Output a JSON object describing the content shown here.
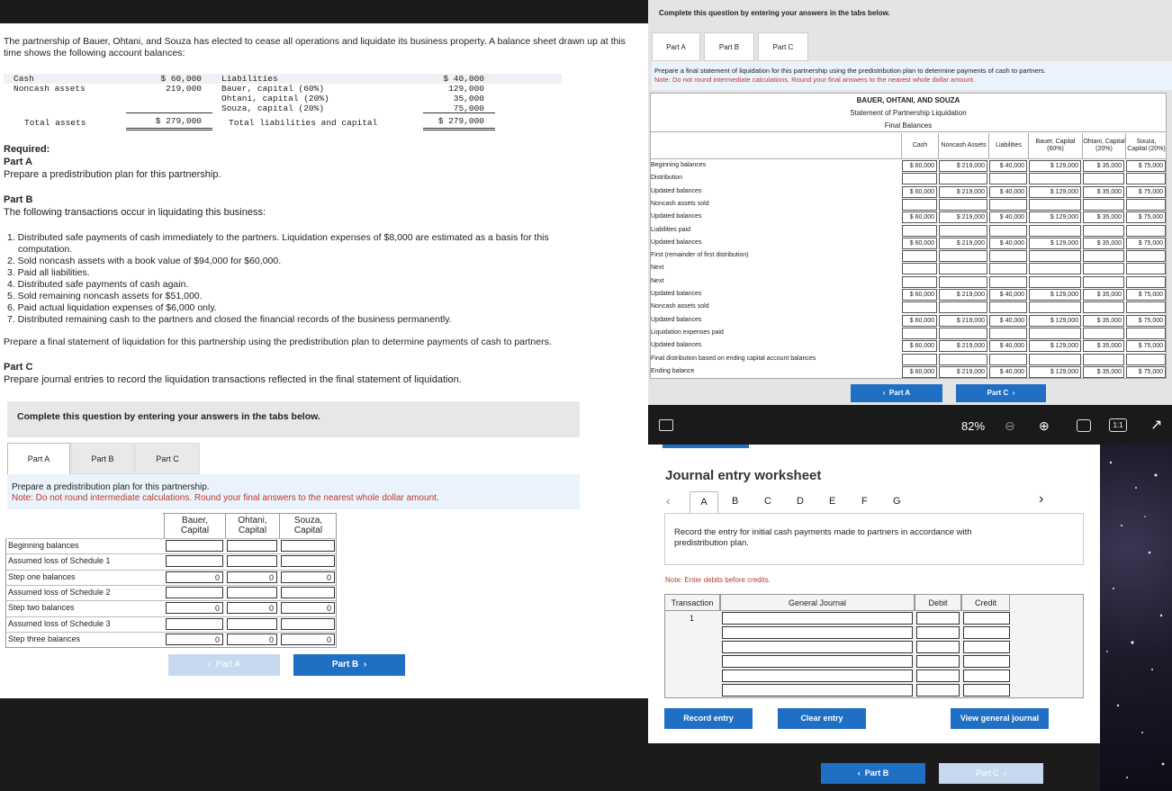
{
  "left": {
    "intro": "The partnership of Bauer, Ohtani, and Souza has elected to cease all operations and liquidate its business property. A balance sheet drawn up at this time shows the following account balances:",
    "bs": {
      "cash_label": "Cash",
      "cash_val": "$ 60,000",
      "nca_label": "Noncash assets",
      "nca_val": "219,000",
      "total_label": "Total assets",
      "total_val": "$ 279,000",
      "liab_label": "Liabilities",
      "liab_val": "$ 40,000",
      "bauer_label": "Bauer, capital (60%)",
      "bauer_val": "129,000",
      "ohtani_label": "Ohtani, capital (20%)",
      "ohtani_val": "35,000",
      "souza_label": "Souza, capital (20%)",
      "souza_val": "75,000",
      "tlc_label": "Total liabilities and capital",
      "tlc_val": "$ 279,000"
    },
    "required": "Required:",
    "partA_h": "Part A",
    "partA_t": "Prepare a predistribution plan for this partnership.",
    "partB_h": "Part B",
    "partB_t": "The following transactions occur in liquidating this business:",
    "steps": [
      "1. Distributed safe payments of cash immediately to the partners. Liquidation expenses of $8,000 are estimated as a basis for this",
      "computation.",
      "2. Sold noncash assets with a book value of $94,000 for $60,000.",
      "3. Paid all liabilities.",
      "4. Distributed safe payments of cash again.",
      "5. Sold remaining noncash assets for $51,000.",
      "6. Paid actual liquidation expenses of $6,000 only.",
      "7. Distributed remaining cash to the partners and closed the financial records of the business permanently."
    ],
    "partB_final": "Prepare a final statement of liquidation for this partnership using the predistribution plan to determine payments of cash to partners.",
    "partC_h": "Part C",
    "partC_t": "Prepare journal entries to record the liquidation transactions reflected in the final statement of liquidation.",
    "complete": "Complete this question by entering your answers in the tabs below.",
    "tabs": [
      "Part A",
      "Part B",
      "Part C"
    ],
    "instr": "Prepare a predistribution plan for this partnership.",
    "note": "Note: Do not round intermediate calculations. Round your final answers to the nearest whole dollar amount.",
    "cols": [
      "Bauer, Capital",
      "Ohtani, Capital",
      "Souza, Capital"
    ],
    "rows": [
      {
        "label": "Beginning balances",
        "v": [
          "",
          "",
          ""
        ]
      },
      {
        "label": "Assumed loss of Schedule 1",
        "v": [
          "",
          "",
          ""
        ]
      },
      {
        "label": "Step one balances",
        "v": [
          "0",
          "0",
          "0"
        ]
      },
      {
        "label": "Assumed loss of Schedule 2",
        "v": [
          "",
          "",
          ""
        ]
      },
      {
        "label": "Step two balances",
        "v": [
          "0",
          "0",
          "0"
        ]
      },
      {
        "label": "Assumed loss of Schedule 3",
        "v": [
          "",
          "",
          ""
        ]
      },
      {
        "label": "Step three balances",
        "v": [
          "0",
          "0",
          "0"
        ]
      }
    ],
    "prev": "Part A",
    "next": "Part B"
  },
  "right": {
    "complete": "Complete this question by entering your answers in the tabs below.",
    "tabs": [
      "Part A",
      "Part B",
      "Part C"
    ],
    "instr": "Prepare a final statement of liquidation for this partnership using the predistribution plan to determine payments of cash to partners.",
    "note": "Note: Do not round intermediate calculations. Round your final answers to the nearest whole dollar amount.",
    "t1": "BAUER, OHTANI, AND SOUZA",
    "t2": "Statement of Partnership Liquidation",
    "t3": "Final Balances",
    "cols": [
      "Cash",
      "Noncash Assets",
      "Liabilities",
      "Bauer, Capital (60%)",
      "Ohtani, Capital (20%)",
      "Souza, Capital (20%)"
    ],
    "rows": [
      {
        "label": "Beginning balances",
        "v": [
          "$ 60,000",
          "$ 219,000",
          "$ 40,000",
          "$ 129,000",
          "$ 35,000",
          "$ 75,000"
        ]
      },
      {
        "label": "Distribution",
        "v": null
      },
      {
        "label": "Updated balances",
        "v": [
          "$ 60,000",
          "$ 219,000",
          "$ 40,000",
          "$ 129,000",
          "$ 35,000",
          "$ 75,000"
        ]
      },
      {
        "label": "Noncash assets sold",
        "v": null
      },
      {
        "label": "Updated balances",
        "v": [
          "$ 60,000",
          "$ 219,000",
          "$ 40,000",
          "$ 129,000",
          "$ 35,000",
          "$ 75,000"
        ]
      },
      {
        "label": "Liabilities paid",
        "v": null
      },
      {
        "label": "Updated balances",
        "v": [
          "$ 60,000",
          "$ 219,000",
          "$ 40,000",
          "$ 129,000",
          "$ 35,000",
          "$ 75,000"
        ]
      },
      {
        "label": "First (remainder of first distribution)",
        "v": null
      },
      {
        "label": "Next",
        "v": null
      },
      {
        "label": "Next",
        "v": null
      },
      {
        "label": "Updated balances",
        "v": [
          "$ 60,000",
          "$ 219,000",
          "$ 40,000",
          "$ 129,000",
          "$ 35,000",
          "$ 75,000"
        ]
      },
      {
        "label": "Noncash assets sold",
        "v": null
      },
      {
        "label": "Updated balances",
        "v": [
          "$ 60,000",
          "$ 219,000",
          "$ 40,000",
          "$ 129,000",
          "$ 35,000",
          "$ 75,000"
        ]
      },
      {
        "label": "Liquidation expenses paid",
        "v": null
      },
      {
        "label": "Updated balances",
        "v": [
          "$ 60,000",
          "$ 219,000",
          "$ 40,000",
          "$ 129,000",
          "$ 35,000",
          "$ 75,000"
        ]
      },
      {
        "label": "Final distribution based on ending capital account balances",
        "v": null
      },
      {
        "label": "Ending balance",
        "v": [
          "$ 60,000",
          "$ 219,000",
          "$ 40,000",
          "$ 129,000",
          "$ 35,000",
          "$ 75,000"
        ]
      }
    ],
    "prev": "Part A",
    "next": "Part C",
    "zoom": "82%",
    "one": "1:1"
  },
  "journal": {
    "title": "Journal entry worksheet",
    "letters": [
      "A",
      "B",
      "C",
      "D",
      "E",
      "F",
      "G"
    ],
    "record": "Record the entry for initial cash payments made to partners in accordance with predistribution plan.",
    "note": "Note: Enter debits before credits.",
    "h_trans": "Transaction",
    "h_gj": "General Journal",
    "h_debit": "Debit",
    "h_credit": "Credit",
    "trans": "1",
    "b_record": "Record entry",
    "b_clear": "Clear entry",
    "b_view": "View general journal",
    "prev": "Part B",
    "next": "Part C"
  }
}
